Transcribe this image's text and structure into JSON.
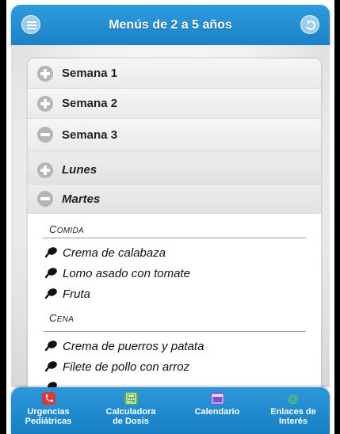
{
  "header": {
    "title": "Menús de 2 a 5 años"
  },
  "weeks": [
    {
      "label": "Semana 1",
      "icon": "plus-circle-icon",
      "state": "collapsed"
    },
    {
      "label": "Semana 2",
      "icon": "plus-circle-icon",
      "state": "collapsed"
    },
    {
      "label": "Semana 3",
      "icon": "minus-circle-icon",
      "state": "expanded"
    }
  ],
  "days": [
    {
      "label": "Lunes",
      "icon": "plus-circle-icon",
      "state": "collapsed"
    },
    {
      "label": "Martes",
      "icon": "minus-circle-icon",
      "state": "expanded"
    }
  ],
  "menu": {
    "comida": {
      "first": "C",
      "rest": "OMIDA",
      "items": [
        "Crema de calabaza",
        "Lomo asado con tomate",
        "Fruta"
      ]
    },
    "cena": {
      "first": "C",
      "rest": "ENA",
      "items": [
        "Crema de puerros y patata",
        "Filete de pollo con arroz"
      ]
    }
  },
  "footer": {
    "tabs": [
      {
        "line1": "Urgencias",
        "line2": "Pediátricas",
        "icon": "phone-icon",
        "color": "#d9393b"
      },
      {
        "line1": "Calculadora",
        "line2": "de Dosis",
        "icon": "calculator-icon",
        "color": "#5fae4a"
      },
      {
        "line1": "Calendario",
        "line2": "",
        "icon": "calendar-icon",
        "color": "#7b55c8"
      },
      {
        "line1": "Enlaces de",
        "line2": "Interés",
        "icon": "at-sign-icon",
        "color": "#6fcf4a"
      }
    ]
  },
  "colors": {
    "header_blue": "#1f89cf",
    "footer_blue": "#1f89cf"
  }
}
